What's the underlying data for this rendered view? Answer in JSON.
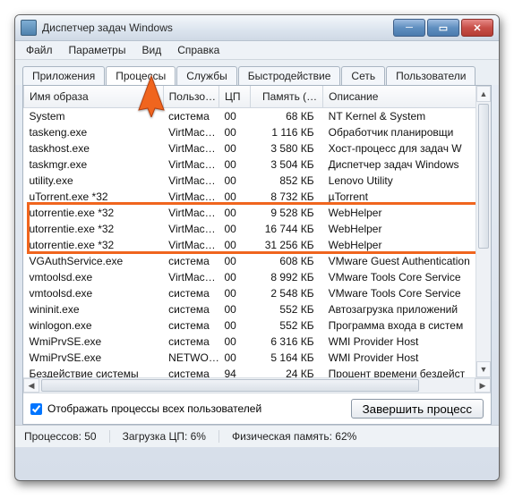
{
  "window": {
    "title": "Диспетчер задач Windows"
  },
  "menu": {
    "file": "Файл",
    "options": "Параметры",
    "view": "Вид",
    "help": "Справка"
  },
  "tabs": {
    "apps": "Приложения",
    "processes": "Процессы",
    "services": "Службы",
    "performance": "Быстродействие",
    "network": "Сеть",
    "users": "Пользователи"
  },
  "columns": {
    "image_name": "Имя образа",
    "user": "Пользо…",
    "cpu": "ЦП",
    "memory": "Память (…",
    "description": "Описание"
  },
  "rows": [
    {
      "name": "System",
      "user": "система",
      "cpu": "00",
      "mem": "68 КБ",
      "desc": "NT Kernel & System"
    },
    {
      "name": "taskeng.exe",
      "user": "VirtMac…",
      "cpu": "00",
      "mem": "1 116 КБ",
      "desc": "Обработчик планировщи"
    },
    {
      "name": "taskhost.exe",
      "user": "VirtMac…",
      "cpu": "00",
      "mem": "3 580 КБ",
      "desc": "Хост-процесс для задач W"
    },
    {
      "name": "taskmgr.exe",
      "user": "VirtMac…",
      "cpu": "00",
      "mem": "3 504 КБ",
      "desc": "Диспетчер задач Windows"
    },
    {
      "name": "utility.exe",
      "user": "VirtMac…",
      "cpu": "00",
      "mem": "852 КБ",
      "desc": "Lenovo Utility"
    },
    {
      "name": "uTorrent.exe *32",
      "user": "VirtMac…",
      "cpu": "00",
      "mem": "8 732 КБ",
      "desc": "µTorrent"
    },
    {
      "name": "utorrentie.exe *32",
      "user": "VirtMac…",
      "cpu": "00",
      "mem": "9 528 КБ",
      "desc": "WebHelper"
    },
    {
      "name": "utorrentie.exe *32",
      "user": "VirtMac…",
      "cpu": "00",
      "mem": "16 744 КБ",
      "desc": "WebHelper"
    },
    {
      "name": "utorrentie.exe *32",
      "user": "VirtMac…",
      "cpu": "00",
      "mem": "31 256 КБ",
      "desc": "WebHelper"
    },
    {
      "name": "VGAuthService.exe",
      "user": "система",
      "cpu": "00",
      "mem": "608 КБ",
      "desc": "VMware Guest Authentication"
    },
    {
      "name": "vmtoolsd.exe",
      "user": "VirtMac…",
      "cpu": "00",
      "mem": "8 992 КБ",
      "desc": "VMware Tools Core Service"
    },
    {
      "name": "vmtoolsd.exe",
      "user": "система",
      "cpu": "00",
      "mem": "2 548 КБ",
      "desc": "VMware Tools Core Service"
    },
    {
      "name": "wininit.exe",
      "user": "система",
      "cpu": "00",
      "mem": "552 КБ",
      "desc": "Автозагрузка приложений"
    },
    {
      "name": "winlogon.exe",
      "user": "система",
      "cpu": "00",
      "mem": "552 КБ",
      "desc": "Программа входа в систем"
    },
    {
      "name": "WmiPrvSE.exe",
      "user": "система",
      "cpu": "00",
      "mem": "6 316 КБ",
      "desc": "WMI Provider Host"
    },
    {
      "name": "WmiPrvSE.exe",
      "user": "NETWO…",
      "cpu": "00",
      "mem": "5 164 КБ",
      "desc": "WMI Provider Host"
    },
    {
      "name": "Бездействие системы",
      "user": "система",
      "cpu": "94",
      "mem": "24 КБ",
      "desc": "Процент времени бездейст"
    }
  ],
  "checkbox": {
    "label": "Отображать процессы всех пользователей",
    "checked": true
  },
  "buttons": {
    "end_process": "Завершить процесс"
  },
  "status": {
    "processes": "Процессов: 50",
    "cpu": "Загрузка ЦП: 6%",
    "mem": "Физическая память: 62%"
  },
  "highlight_group": {
    "first_row_index": 6,
    "last_row_index": 8
  }
}
